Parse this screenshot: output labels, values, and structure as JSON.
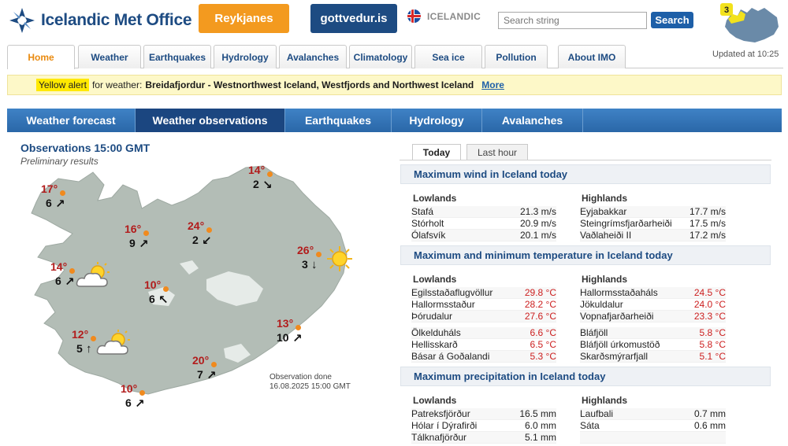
{
  "header": {
    "logo_text": "Icelandic Met Office",
    "region_button": "Reykjanes",
    "gottvedur_button": "gottvedur.is",
    "language": "ICELANDIC",
    "search_placeholder": "Search string",
    "search_button": "Search",
    "alert_count": "3",
    "updated": "Updated at 10:25"
  },
  "nav": {
    "tabs": [
      "Home",
      "Weather",
      "Earthquakes",
      "Hydrology",
      "Avalanches",
      "Climatology",
      "Sea ice",
      "Pollution",
      "About IMO"
    ],
    "active": "Home"
  },
  "alert": {
    "level": "Yellow alert",
    "text": "for weather:",
    "regions": "Breidafjordur - Westnorthwest Iceland, Westfjords and Northwest Iceland",
    "more": "More"
  },
  "section_tabs": {
    "items": [
      "Weather forecast",
      "Weather observations",
      "Earthquakes",
      "Hydrology",
      "Avalanches"
    ],
    "active": "Weather observations"
  },
  "observations": {
    "title": "Observations 15:00 GMT",
    "subtitle": "Preliminary results",
    "note_line1": "Observation done",
    "note_line2": "16.08.2025 15:00 GMT",
    "stations": [
      {
        "temp": "17°",
        "wind": "6",
        "arrow": "↗"
      },
      {
        "temp": "14°",
        "wind": "2",
        "arrow": "↘"
      },
      {
        "temp": "16°",
        "wind": "9",
        "arrow": "↗"
      },
      {
        "temp": "24°",
        "wind": "2",
        "arrow": "↙"
      },
      {
        "temp": "26°",
        "wind": "3",
        "arrow": "↓"
      },
      {
        "temp": "14°",
        "wind": "6",
        "arrow": "↗"
      },
      {
        "temp": "10°",
        "wind": "6",
        "arrow": "↖"
      },
      {
        "temp": "13°",
        "wind": "10",
        "arrow": "↗"
      },
      {
        "temp": "12°",
        "wind": "5",
        "arrow": "↑"
      },
      {
        "temp": "20°",
        "wind": "7",
        "arrow": "↗"
      },
      {
        "temp": "10°",
        "wind": "6",
        "arrow": "↗"
      }
    ]
  },
  "right_tabs": {
    "items": [
      "Today",
      "Last hour"
    ],
    "active": "Today"
  },
  "max_wind": {
    "title": "Maximum wind in Iceland today",
    "lowlands_label": "Lowlands",
    "highlands_label": "Highlands",
    "lowlands": [
      {
        "name": "Stafá",
        "value": "21.3 m/s"
      },
      {
        "name": "Stórholt",
        "value": "20.9 m/s"
      },
      {
        "name": "Ólafsvík",
        "value": "20.1 m/s"
      }
    ],
    "highlands": [
      {
        "name": "Eyjabakkar",
        "value": "17.7 m/s"
      },
      {
        "name": "Steingrímsfjarðarheiði",
        "value": "17.5 m/s"
      },
      {
        "name": "Vaðlaheiði II",
        "value": "17.2 m/s"
      }
    ]
  },
  "max_min_temp": {
    "title": "Maximum and minimum temperature in Iceland today",
    "lowlands_label": "Lowlands",
    "highlands_label": "Highlands",
    "lowlands_max": [
      {
        "name": "Egilsstaðaflugvöllur",
        "value": "29.8 °C"
      },
      {
        "name": "Hallormsstaður",
        "value": "28.2 °C"
      },
      {
        "name": "Þórudalur",
        "value": "27.6 °C"
      }
    ],
    "highlands_max": [
      {
        "name": "Hallormsstaðaháls",
        "value": "24.5 °C"
      },
      {
        "name": "Jökuldalur",
        "value": "24.0 °C"
      },
      {
        "name": "Vopnafjarðarheiði",
        "value": "23.3 °C"
      }
    ],
    "lowlands_min": [
      {
        "name": "Ölkelduháls",
        "value": "6.6 °C"
      },
      {
        "name": "Hellisskarð",
        "value": "6.5 °C"
      },
      {
        "name": "Básar á Goðalandi",
        "value": "5.3 °C"
      }
    ],
    "highlands_min": [
      {
        "name": "Bláfjöll",
        "value": "5.8 °C"
      },
      {
        "name": "Bláfjöll úrkomustöð",
        "value": "5.8 °C"
      },
      {
        "name": "Skarðsmýrarfjall",
        "value": "5.1 °C"
      }
    ]
  },
  "max_precip": {
    "title": "Maximum precipitation in Iceland today",
    "lowlands_label": "Lowlands",
    "highlands_label": "Highlands",
    "lowlands": [
      {
        "name": "Patreksfjörður",
        "value": "16.5 mm"
      },
      {
        "name": "Hólar í Dýrafirði",
        "value": "6.0 mm"
      },
      {
        "name": "Tálknafjörður",
        "value": "5.1 mm"
      }
    ],
    "highlands": [
      {
        "name": "Laufbali",
        "value": "0.7 mm"
      },
      {
        "name": "Sáta",
        "value": "0.6 mm"
      }
    ]
  },
  "colors": {
    "brand_blue": "#1d4b82",
    "accent_orange": "#f39a1f",
    "alert_yellow": "#ffe900",
    "temp_red": "#b21c1c"
  }
}
